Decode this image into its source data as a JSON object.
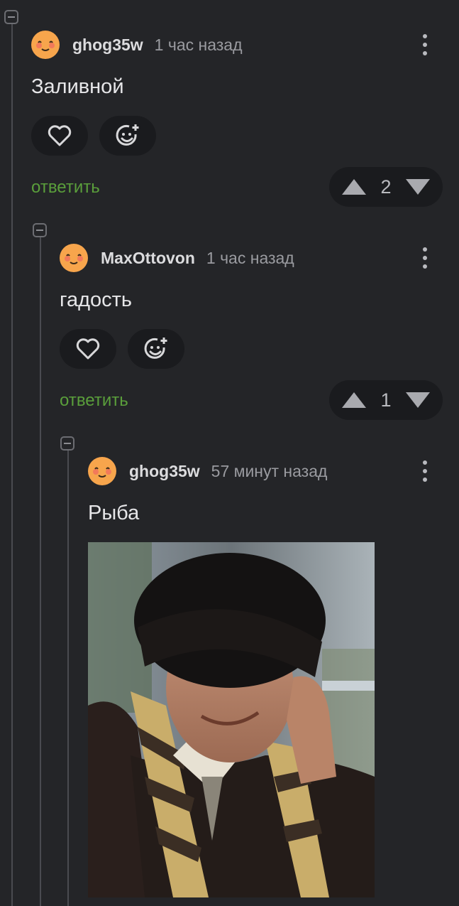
{
  "comments": [
    {
      "username": "ghog35w",
      "time": "1 час назад",
      "text": "Заливной",
      "reply_label": "ответить",
      "score": "2"
    },
    {
      "username": "MaxOttovon",
      "time": "1 час назад",
      "text": "гадость",
      "reply_label": "ответить",
      "score": "1"
    },
    {
      "username": "ghog35w",
      "time": "57 минут назад",
      "text": "Рыба"
    }
  ],
  "icons": {
    "like": "heart-icon",
    "reaction": "add-emoji-icon",
    "upvote": "arrow-up-icon",
    "downvote": "arrow-down-icon",
    "menu": "more-vertical-icon",
    "collapse": "collapse-minus-icon"
  },
  "colors": {
    "background": "#242528",
    "reply_link": "#5a9e3b",
    "avatar": "#f7a54c"
  }
}
